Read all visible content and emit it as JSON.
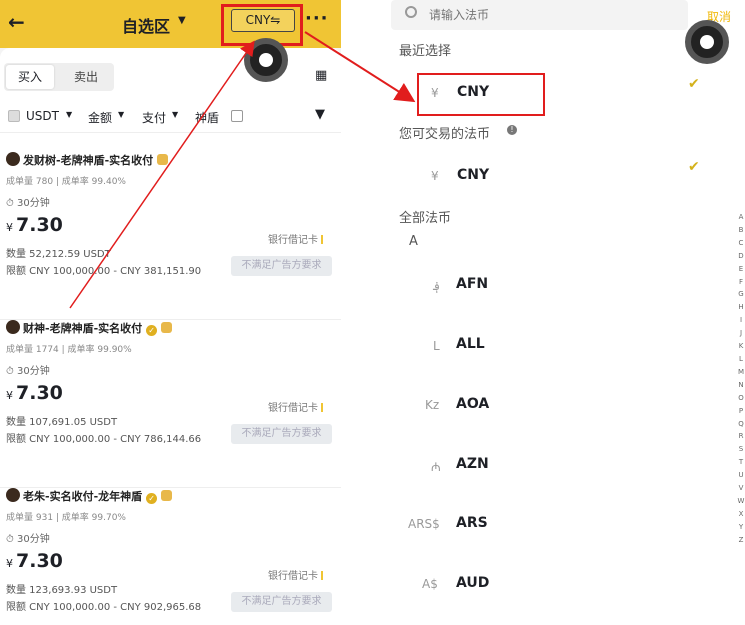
{
  "left": {
    "title": "自选区",
    "currency_button": "CNY⇋",
    "more": "···",
    "tabs": [
      "买入",
      "卖出"
    ],
    "filters": {
      "asset": "USDT",
      "amount": "金额",
      "payment": "支付",
      "shield": "神盾"
    },
    "merchants": [
      {
        "name": "发财树-老牌神盾-实名收付",
        "verified": false,
        "stats": "成单量 780 | 成单率 99.40%",
        "time": "30分钟",
        "currency_symbol": "¥",
        "price": "7.30",
        "payment": "银行借记卡",
        "quantity": "数量 52,212.59 USDT",
        "limit": "限额 CNY 100,000.00 - CNY 381,151.90",
        "requirement": "不满足广告方要求"
      },
      {
        "name": "财神-老牌神盾-实名收付",
        "verified": true,
        "stats": "成单量 1774 | 成单率 99.90%",
        "time": "30分钟",
        "currency_symbol": "¥",
        "price": "7.30",
        "payment": "银行借记卡",
        "quantity": "数量 107,691.05 USDT",
        "limit": "限额 CNY 100,000.00 - CNY 786,144.66",
        "requirement": "不满足广告方要求"
      },
      {
        "name": "老朱-实名收付-龙年神盾",
        "verified": true,
        "stats": "成单量 931 | 成单率 99.70%",
        "time": "30分钟",
        "currency_symbol": "¥",
        "price": "7.30",
        "payment": "银行借记卡",
        "quantity": "数量 123,693.93 USDT",
        "limit": "限额 CNY 100,000.00 - CNY 902,965.68",
        "requirement": "不满足广告方要求"
      }
    ]
  },
  "right": {
    "search_placeholder": "请输入法币",
    "cancel": "取消",
    "recent_heading": "最近选择",
    "recent": [
      {
        "symbol": "¥",
        "code": "CNY",
        "selected": true
      }
    ],
    "tradable_heading": "您可交易的法币",
    "tradable": [
      {
        "symbol": "¥",
        "code": "CNY",
        "selected": true
      }
    ],
    "all_heading": "全部法币",
    "letter": "A",
    "all": [
      {
        "symbol": "؋",
        "code": "AFN"
      },
      {
        "symbol": "L",
        "code": "ALL"
      },
      {
        "symbol": "Kz",
        "code": "AOA"
      },
      {
        "symbol": "₼",
        "code": "AZN"
      },
      {
        "symbol": "ARS$",
        "code": "ARS"
      },
      {
        "symbol": "A$",
        "code": "AUD"
      }
    ],
    "alphabet": [
      "A",
      "B",
      "C",
      "D",
      "E",
      "F",
      "G",
      "H",
      "I",
      "J",
      "K",
      "L",
      "M",
      "N",
      "O",
      "P",
      "Q",
      "R",
      "S",
      "T",
      "U",
      "V",
      "W",
      "X",
      "Y",
      "Z"
    ]
  },
  "colors": {
    "brand_yellow": "#f0c534",
    "annotation_red": "#e11d1d",
    "check": "#d4b21c"
  }
}
